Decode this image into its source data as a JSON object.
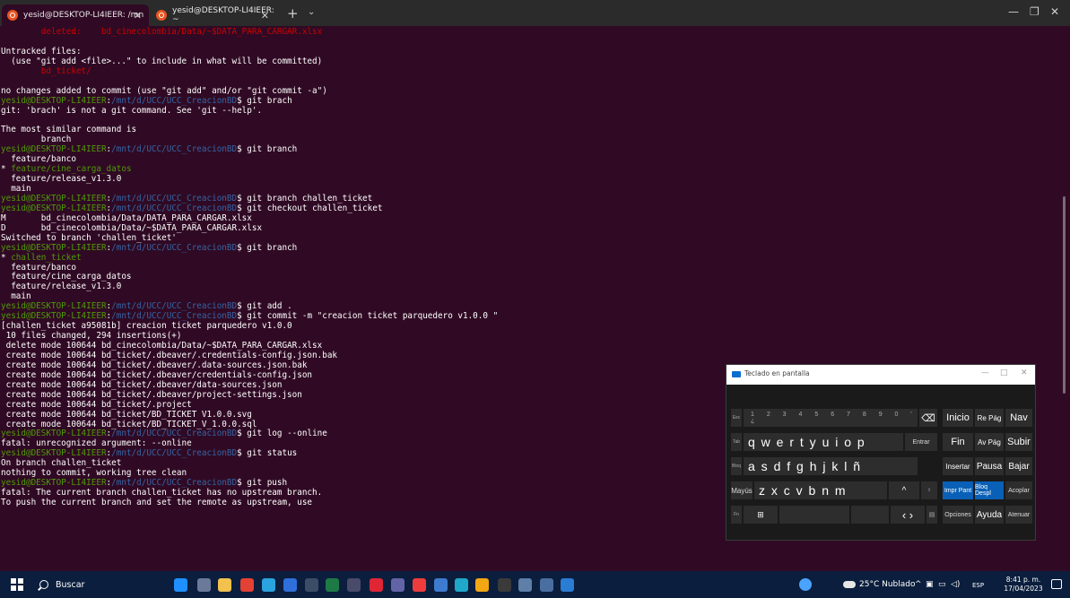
{
  "tabs": [
    {
      "title": "yesid@DESKTOP-LI4IEER: /mn",
      "active": true
    },
    {
      "title": "yesid@DESKTOP-LI4IEER: ~",
      "active": false
    }
  ],
  "prompt": {
    "user": "yesid@DESKTOP-LI4IEER",
    "path": "/mnt/d/UCC/UCC_CreacionBD"
  },
  "terminal_lines": [
    [
      {
        "t": "        deleted:    bd_cinecolombia/Data/~$DATA_PARA_CARGAR.xlsx",
        "c": "r"
      }
    ],
    [],
    [
      {
        "t": "Untracked files:"
      }
    ],
    [
      {
        "t": "  (use \"git add <file>...\" to include in what will be committed)"
      }
    ],
    [
      {
        "t": "        bd_ticket/",
        "c": "r"
      }
    ],
    [],
    [
      {
        "t": "no changes added to commit (use \"git add\" and/or \"git commit -a\")"
      }
    ],
    [
      {
        "prompt": true
      },
      {
        "t": " git brach"
      }
    ],
    [
      {
        "t": "git: 'brach' is not a git command. See 'git --help'."
      }
    ],
    [],
    [
      {
        "t": "The most similar command is"
      }
    ],
    [
      {
        "t": "        branch"
      }
    ],
    [
      {
        "prompt": true
      },
      {
        "t": " git branch"
      }
    ],
    [
      {
        "t": "  feature/banco"
      }
    ],
    [
      {
        "t": "* "
      },
      {
        "t": "feature/cine_carga_datos",
        "c": "g"
      }
    ],
    [
      {
        "t": "  feature/release_v1.3.0"
      }
    ],
    [
      {
        "t": "  main"
      }
    ],
    [
      {
        "prompt": true
      },
      {
        "t": " git branch challen_ticket"
      }
    ],
    [
      {
        "prompt": true
      },
      {
        "t": " git checkout challen_ticket"
      }
    ],
    [
      {
        "t": "M       bd_cinecolombia/Data/DATA_PARA_CARGAR.xlsx"
      }
    ],
    [
      {
        "t": "D       bd_cinecolombia/Data/~$DATA_PARA_CARGAR.xlsx"
      }
    ],
    [
      {
        "t": "Switched to branch 'challen_ticket'"
      }
    ],
    [
      {
        "prompt": true
      },
      {
        "t": " git branch"
      }
    ],
    [
      {
        "t": "* "
      },
      {
        "t": "challen_ticket",
        "c": "g"
      }
    ],
    [
      {
        "t": "  feature/banco"
      }
    ],
    [
      {
        "t": "  feature/cine_carga_datos"
      }
    ],
    [
      {
        "t": "  feature/release_v1.3.0"
      }
    ],
    [
      {
        "t": "  main"
      }
    ],
    [
      {
        "prompt": true
      },
      {
        "t": " git add ."
      }
    ],
    [
      {
        "prompt": true
      },
      {
        "t": " git commit -m \"creacion ticket parquedero v1.0.0 \""
      }
    ],
    [
      {
        "t": "[challen_ticket a95081b] creacion ticket parquedero v1.0.0"
      }
    ],
    [
      {
        "t": " 10 files changed, 294 insertions(+)"
      }
    ],
    [
      {
        "t": " delete mode 100644 bd_cinecolombia/Data/~$DATA_PARA_CARGAR.xlsx"
      }
    ],
    [
      {
        "t": " create mode 100644 bd_ticket/.dbeaver/.credentials-config.json.bak"
      }
    ],
    [
      {
        "t": " create mode 100644 bd_ticket/.dbeaver/.data-sources.json.bak"
      }
    ],
    [
      {
        "t": " create mode 100644 bd_ticket/.dbeaver/credentials-config.json"
      }
    ],
    [
      {
        "t": " create mode 100644 bd_ticket/.dbeaver/data-sources.json"
      }
    ],
    [
      {
        "t": " create mode 100644 bd_ticket/.dbeaver/project-settings.json"
      }
    ],
    [
      {
        "t": " create mode 100644 bd_ticket/.project"
      }
    ],
    [
      {
        "t": " create mode 100644 bd_ticket/BD_TICKET V1.0.0.svg"
      }
    ],
    [
      {
        "t": " create mode 100644 bd_ticket/BD_TICKET_V_1.0.0.sql"
      }
    ],
    [
      {
        "prompt": true
      },
      {
        "t": " git log --online"
      }
    ],
    [
      {
        "t": "fatal: unrecognized argument: --online"
      }
    ],
    [
      {
        "prompt": true
      },
      {
        "t": " git status"
      }
    ],
    [
      {
        "t": "On branch challen_ticket"
      }
    ],
    [
      {
        "t": "nothing to commit, working tree clean"
      }
    ],
    [
      {
        "prompt": true
      },
      {
        "t": " git push"
      }
    ],
    [
      {
        "t": "fatal: The current branch challen_ticket has no upstream branch."
      }
    ],
    [
      {
        "t": "To push the current branch and set the remote as upstream, use"
      }
    ]
  ],
  "osk": {
    "title": "Teclado en pantalla",
    "row1": [
      "Inicio",
      "Re Pág",
      "Nav"
    ],
    "row2": [
      "Fin",
      "Av Pág",
      "Subir"
    ],
    "row3": [
      "Insertar",
      "Pausa",
      "Bajar"
    ],
    "row4": [
      "Impr Pant",
      "Bloq Despl",
      "Acoplar"
    ],
    "row5": [
      "Opciones",
      "Ayuda",
      "Atenuar"
    ],
    "enter": "Entrar",
    "mayus": "Mayús",
    "letters_row2": "q w e r t y u i o p",
    "letters_row3": "a s d f g h j k l ñ",
    "letters_row4": "z x c v b n m"
  },
  "taskbar": {
    "search_placeholder": "Buscar",
    "weather": "25°C  Nublado",
    "language": "ESP",
    "time": "8:41 p. m.",
    "date": "17/04/2023",
    "colors": {
      "accent": "#e95420",
      "terminal_bg": "#300a24",
      "taskbar_bg": "#0b1e3d"
    }
  }
}
